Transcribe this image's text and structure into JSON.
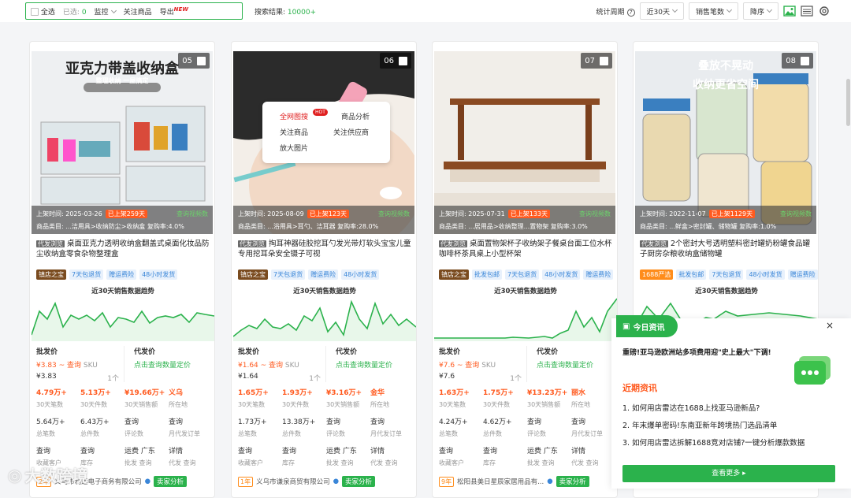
{
  "toolbar": {
    "select_all": "全选",
    "selected_label": "已选:",
    "selected_count": "0",
    "monitor": "监控",
    "follow": "关注商品",
    "export": "导出",
    "export_badge": "NEW",
    "result_label": "搜索结果:",
    "result_count": "10000+",
    "period_label": "统计周期",
    "period_value": "近30天",
    "sort_field": "销售笔数",
    "sort_order": "降序"
  },
  "cards": [
    {
      "index": "05",
      "image_headline": "亚克力带盖收纳盒",
      "image_sub": "整理收纳 一屋搞定",
      "listed": "上架时间: 2025-03-26",
      "hot_days": "已上架259天",
      "video": "查询视频数",
      "category": "商品类目: ...洁用具>收纳防尘>收纳盒",
      "repurchase": "复购率:4.0%",
      "source_tag": "代发浏览",
      "title": "桌面亚克力透明收纳盒翻盖式桌面化妆品防尘收纳盒零食杂物整理盒",
      "tags": [
        "镇店之宝",
        "7天包退货",
        "赠运费险",
        "48小时发货"
      ],
      "trend_title": "近30天销售数据趋势",
      "wholesale_label": "批发价",
      "wholesale_price": "¥3.83 ~ 查询",
      "sku": "SKU",
      "sku_price": "¥3.83",
      "sku_count": "1个",
      "dropship_label": "代发价",
      "dropship_link": "点击查询数量定价",
      "stats": [
        {
          "v": "4.79万+",
          "l": "30天笔数",
          "hl": true
        },
        {
          "v": "5.13万+",
          "l": "30天件数",
          "hl": true
        },
        {
          "v": "¥19.66万+",
          "l": "30天销售额",
          "hl": true
        },
        {
          "v": "义乌",
          "l": "所在地",
          "hl": true
        },
        {
          "v": "5.64万+",
          "l": "总笔数",
          "hl": false
        },
        {
          "v": "6.43万+",
          "l": "总件数",
          "hl": false
        },
        {
          "v": "查询",
          "l": "评论数",
          "hl": false
        },
        {
          "v": "查询",
          "l": "月代发订单",
          "hl": false
        },
        {
          "v": "查询",
          "l": "收藏客户",
          "hl": false
        },
        {
          "v": "查询",
          "l": "库存",
          "hl": false
        },
        {
          "v": "运费 广东",
          "l": "批发 查询",
          "hl": false
        },
        {
          "v": "详情",
          "l": "代发 查询",
          "hl": false
        }
      ],
      "year_badge": "2年",
      "company": "义乌市利远电子商务有限公司",
      "seller_btn": "卖家分析"
    },
    {
      "index": "06",
      "image_headline": "",
      "image_sub": "",
      "listed": "上架时间: 2025-08-09",
      "hot_days": "已上架123天",
      "video": "查询视频数",
      "category": "商品类目: ...浴用具>耳勺、洁耳器",
      "repurchase": "复购率:28.0%",
      "source_tag": "代发浏览",
      "title": "掏耳神器硅胶挖耳勺发光带灯软头宝宝儿童专用挖耳朵安全镊子可视",
      "tags": [
        "镇店之宝",
        "7天包退货",
        "赠运费险",
        "48小时发货"
      ],
      "trend_title": "近30天销售数据趋势",
      "wholesale_label": "批发价",
      "wholesale_price": "¥1.64 ~ 查询",
      "sku": "SKU",
      "sku_price": "¥1.64",
      "sku_count": "1个",
      "dropship_label": "代发价",
      "dropship_link": "点击查询数量定价",
      "stats": [
        {
          "v": "1.65万+",
          "l": "30天笔数",
          "hl": true
        },
        {
          "v": "1.93万+",
          "l": "30天件数",
          "hl": true
        },
        {
          "v": "¥3.16万+",
          "l": "30天销售额",
          "hl": true
        },
        {
          "v": "金华",
          "l": "所在地",
          "hl": true
        },
        {
          "v": "1.73万+",
          "l": "总笔数",
          "hl": false
        },
        {
          "v": "13.38万+",
          "l": "总件数",
          "hl": false
        },
        {
          "v": "查询",
          "l": "评论数",
          "hl": false
        },
        {
          "v": "查询",
          "l": "月代发订单",
          "hl": false
        },
        {
          "v": "查询",
          "l": "收藏客户",
          "hl": false
        },
        {
          "v": "查询",
          "l": "库存",
          "hl": false
        },
        {
          "v": "运费 广东",
          "l": "批发 查询",
          "hl": false
        },
        {
          "v": "详情",
          "l": "代发 查询",
          "hl": false
        }
      ],
      "year_badge": "1年",
      "company": "义乌市谦泉商贸有限公司",
      "seller_btn": "卖家分析"
    },
    {
      "index": "07",
      "image_headline": "",
      "image_sub": "",
      "listed": "上架时间: 2025-07-31",
      "hot_days": "已上架133天",
      "video": "查询视频数",
      "category": "商品类目: ...居用品>收纳整理...置物架",
      "repurchase": "复购率:3.0%",
      "source_tag": "代发浏览",
      "title": "桌面置物架杯子收纳架子餐桌台面工位水杯咖啡杯茶具桌上小型杯架",
      "tags": [
        "镇店之宝",
        "批发包邮",
        "7天包退货",
        "48小时发货",
        "赠运费险"
      ],
      "trend_title": "近30天销售数据趋势",
      "wholesale_label": "批发价",
      "wholesale_price": "¥7.6 ~ 查询",
      "sku": "SKU",
      "sku_price": "¥7.6",
      "sku_count": "1个",
      "dropship_label": "代发价",
      "dropship_link": "点击查询数量定价",
      "stats": [
        {
          "v": "1.63万+",
          "l": "30天笔数",
          "hl": true
        },
        {
          "v": "1.75万+",
          "l": "30天件数",
          "hl": true
        },
        {
          "v": "¥13.23万+",
          "l": "30天销售额",
          "hl": true
        },
        {
          "v": "丽水",
          "l": "所在地",
          "hl": true
        },
        {
          "v": "4.24万+",
          "l": "总笔数",
          "hl": false
        },
        {
          "v": "4.62万+",
          "l": "总件数",
          "hl": false
        },
        {
          "v": "查询",
          "l": "评论数",
          "hl": false
        },
        {
          "v": "查询",
          "l": "月代发订单",
          "hl": false
        },
        {
          "v": "查询",
          "l": "收藏客户",
          "hl": false
        },
        {
          "v": "查询",
          "l": "库存",
          "hl": false
        },
        {
          "v": "运费 广东",
          "l": "批发 查询",
          "hl": false
        },
        {
          "v": "详情",
          "l": "代发 查询",
          "hl": false
        }
      ],
      "year_badge": "9年",
      "company": "松阳县美日星辰家居用品有...",
      "seller_btn": "卖家分析"
    },
    {
      "index": "08",
      "image_headline": "叠放不晃动",
      "image_sub": "收纳更省空间",
      "listed": "上架时间: 2022-11-07",
      "hot_days": "已上架1129天",
      "video": "查询视频数",
      "category": "商品类目: ...鲜盒>密封罐、储物罐",
      "repurchase": "复购率:1.0%",
      "source_tag": "代发浏览",
      "title": "2个密封大号透明塑料密封罐奶粉罐食品罐子厨房杂粮收纳盒储物罐",
      "tags": [
        "1688严选",
        "批发包邮",
        "7天包退货",
        "48小时发货",
        "赠运费险"
      ],
      "trend_title": "近30天销售数据趋势",
      "wholesale_label": "",
      "wholesale_price": "",
      "sku": "",
      "sku_price": "",
      "sku_count": "",
      "dropship_label": "",
      "dropship_link": "",
      "stats": [],
      "year_badge": "",
      "company": "",
      "seller_btn": ""
    }
  ],
  "popup": {
    "item1": "全网图搜",
    "hot": "HOT",
    "item2": "商品分析",
    "item3": "关注商品",
    "item4": "关注供应商",
    "item5": "放大图片"
  },
  "news": {
    "tab": "今日资讯",
    "headline": "重磅!亚马逊欧洲站多项费用迎\"史上最大\"下调!",
    "section": "近期资讯",
    "items": [
      "1. 如何用店雷达在1688上找亚马逊新品?",
      "2. 年末爆单密码!东南亚新年跨境热门选品清单",
      "3. 如何用店雷达拆解1688竞对店铺?一键分析爆款数据"
    ],
    "more": "查看更多 ▸",
    "close": "×"
  },
  "watermark": "大数跨境",
  "colors": {
    "accent": "#2bb24c",
    "price": "#ff5a1f"
  }
}
